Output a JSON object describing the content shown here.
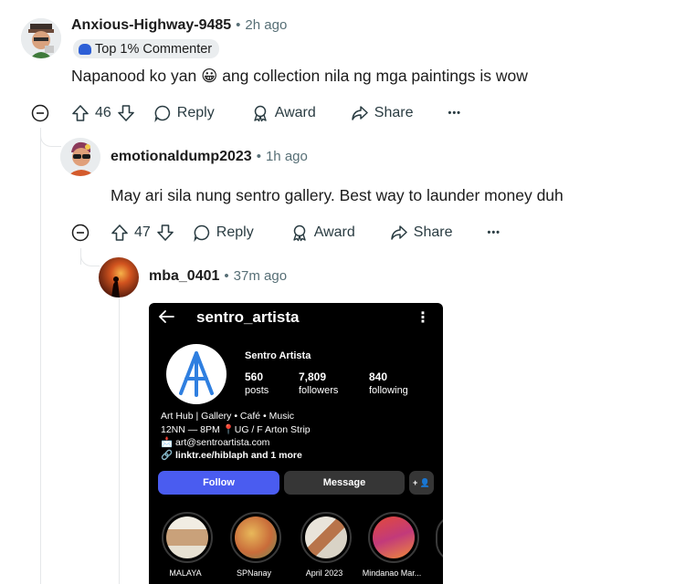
{
  "comments": [
    {
      "author": "Anxious-Highway-9485",
      "time": "2h ago",
      "flair": "Top 1% Commenter",
      "body_before": "Napanood ko yan",
      "emoji": "😀",
      "body_after": "ang collection nila ng mga paintings is wow",
      "votes": "46",
      "reply_label": "Reply",
      "award_label": "Award",
      "share_label": "Share",
      "more_label": "•••"
    },
    {
      "author": "emotionaldump2023",
      "time": "1h ago",
      "body": "May ari sila nung sentro gallery. Best way to launder money duh",
      "votes": "47",
      "reply_label": "Reply",
      "award_label": "Award",
      "share_label": "Share",
      "more_label": "•••"
    },
    {
      "author": "mba_0401",
      "time": "37m ago"
    }
  ],
  "separator": "•",
  "instagram": {
    "back_icon": "arrow-left-icon",
    "handle": "sentro_artista",
    "menu": "⋮",
    "display_name": "Sentro Artista",
    "stats": [
      {
        "value": "560",
        "label": "posts"
      },
      {
        "value": "7,809",
        "label": "followers"
      },
      {
        "value": "840",
        "label": "following"
      }
    ],
    "bio": [
      "Art Hub | Gallery • Café • Music",
      "12NN — 8PM 📍UG / F Arton Strip",
      "📩 art@sentroartista.com",
      "🔗 linktr.ee/hiblaph and 1 more"
    ],
    "follow_label": "Follow",
    "message_label": "Message",
    "add_person": "+ 👤",
    "highlights": [
      "MALAYA",
      "SPNanay",
      "April 2023",
      "Mindanao Mar..."
    ],
    "colors": {
      "follow": "#4a5cf0",
      "message": "#363636",
      "logo": "#2f7fe0"
    }
  }
}
